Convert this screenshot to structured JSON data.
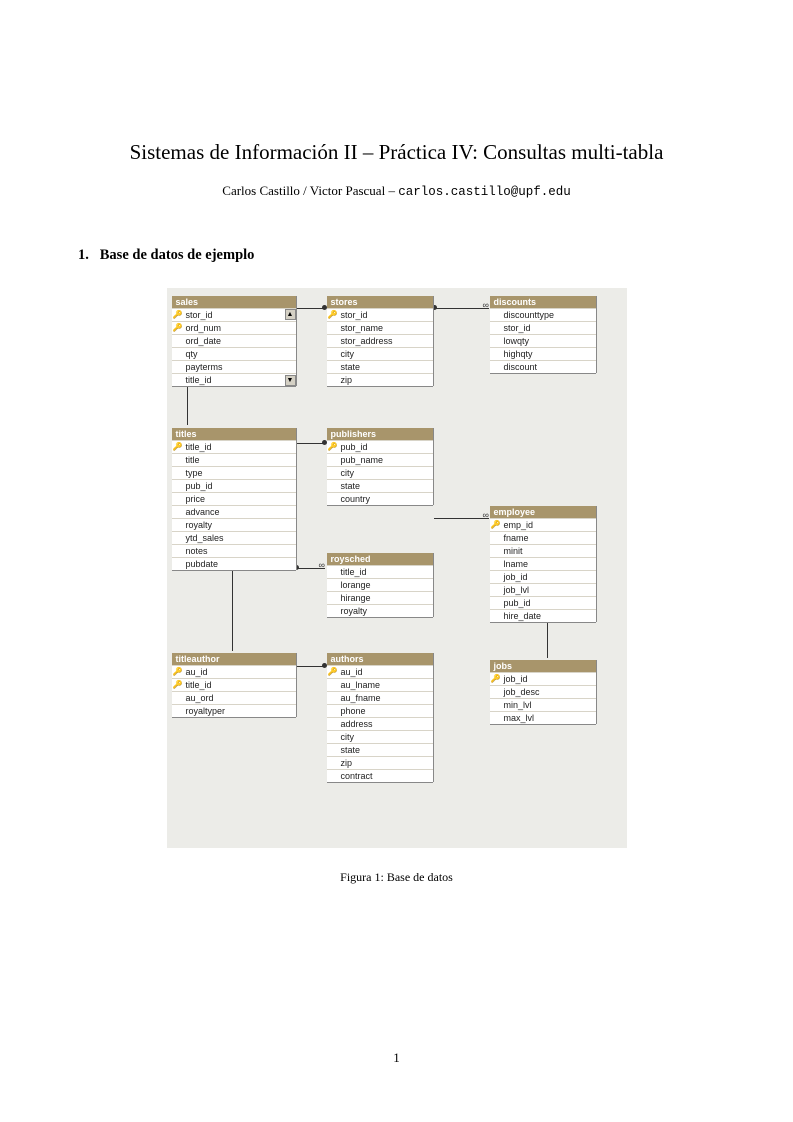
{
  "title": "Sistemas de Información II – Práctica IV: Consultas multi-tabla",
  "authors": "Carlos Castillo / Victor Pascual – ",
  "email": "carlos.castillo@upf.edu",
  "section": {
    "num": "1.",
    "name": "Base de datos de ejemplo"
  },
  "caption": "Figura 1: Base de datos",
  "pagenum": "1",
  "key_glyph": "🔑",
  "scroll_up_glyph": "▲",
  "scroll_dn_glyph": "▼",
  "infinity_glyph": "∞",
  "tables": {
    "sales": {
      "name": "sales",
      "fields": [
        {
          "k": true,
          "n": "stor_id"
        },
        {
          "k": true,
          "n": "ord_num"
        },
        {
          "k": false,
          "n": "ord_date"
        },
        {
          "k": false,
          "n": "qty"
        },
        {
          "k": false,
          "n": "payterms"
        },
        {
          "k": false,
          "n": "title_id"
        }
      ]
    },
    "stores": {
      "name": "stores",
      "fields": [
        {
          "k": true,
          "n": "stor_id"
        },
        {
          "k": false,
          "n": "stor_name"
        },
        {
          "k": false,
          "n": "stor_address"
        },
        {
          "k": false,
          "n": "city"
        },
        {
          "k": false,
          "n": "state"
        },
        {
          "k": false,
          "n": "zip"
        }
      ]
    },
    "discounts": {
      "name": "discounts",
      "fields": [
        {
          "k": false,
          "n": "discounttype"
        },
        {
          "k": false,
          "n": "stor_id"
        },
        {
          "k": false,
          "n": "lowqty"
        },
        {
          "k": false,
          "n": "highqty"
        },
        {
          "k": false,
          "n": "discount"
        }
      ]
    },
    "titles": {
      "name": "titles",
      "fields": [
        {
          "k": true,
          "n": "title_id"
        },
        {
          "k": false,
          "n": "title"
        },
        {
          "k": false,
          "n": "type"
        },
        {
          "k": false,
          "n": "pub_id"
        },
        {
          "k": false,
          "n": "price"
        },
        {
          "k": false,
          "n": "advance"
        },
        {
          "k": false,
          "n": "royalty"
        },
        {
          "k": false,
          "n": "ytd_sales"
        },
        {
          "k": false,
          "n": "notes"
        },
        {
          "k": false,
          "n": "pubdate"
        }
      ]
    },
    "publishers": {
      "name": "publishers",
      "fields": [
        {
          "k": true,
          "n": "pub_id"
        },
        {
          "k": false,
          "n": "pub_name"
        },
        {
          "k": false,
          "n": "city"
        },
        {
          "k": false,
          "n": "state"
        },
        {
          "k": false,
          "n": "country"
        }
      ]
    },
    "roysched": {
      "name": "roysched",
      "fields": [
        {
          "k": false,
          "n": "title_id"
        },
        {
          "k": false,
          "n": "lorange"
        },
        {
          "k": false,
          "n": "hirange"
        },
        {
          "k": false,
          "n": "royalty"
        }
      ]
    },
    "employee": {
      "name": "employee",
      "fields": [
        {
          "k": true,
          "n": "emp_id"
        },
        {
          "k": false,
          "n": "fname"
        },
        {
          "k": false,
          "n": "minit"
        },
        {
          "k": false,
          "n": "lname"
        },
        {
          "k": false,
          "n": "job_id"
        },
        {
          "k": false,
          "n": "job_lvl"
        },
        {
          "k": false,
          "n": "pub_id"
        },
        {
          "k": false,
          "n": "hire_date"
        }
      ]
    },
    "titleauthor": {
      "name": "titleauthor",
      "fields": [
        {
          "k": true,
          "n": "au_id"
        },
        {
          "k": true,
          "n": "title_id"
        },
        {
          "k": false,
          "n": "au_ord"
        },
        {
          "k": false,
          "n": "royaltyper"
        }
      ]
    },
    "authors": {
      "name": "authors",
      "fields": [
        {
          "k": true,
          "n": "au_id"
        },
        {
          "k": false,
          "n": "au_lname"
        },
        {
          "k": false,
          "n": "au_fname"
        },
        {
          "k": false,
          "n": "phone"
        },
        {
          "k": false,
          "n": "address"
        },
        {
          "k": false,
          "n": "city"
        },
        {
          "k": false,
          "n": "state"
        },
        {
          "k": false,
          "n": "zip"
        },
        {
          "k": false,
          "n": "contract"
        }
      ]
    },
    "jobs": {
      "name": "jobs",
      "fields": [
        {
          "k": true,
          "n": "job_id"
        },
        {
          "k": false,
          "n": "job_desc"
        },
        {
          "k": false,
          "n": "min_lvl"
        },
        {
          "k": false,
          "n": "max_lvl"
        }
      ]
    }
  },
  "relationships": [
    {
      "from": "sales.stor_id",
      "to": "stores.stor_id",
      "card": "many-to-one"
    },
    {
      "from": "discounts.stor_id",
      "to": "stores.stor_id",
      "card": "many-to-one"
    },
    {
      "from": "sales.title_id",
      "to": "titles.title_id",
      "card": "many-to-one"
    },
    {
      "from": "titles.pub_id",
      "to": "publishers.pub_id",
      "card": "many-to-one"
    },
    {
      "from": "roysched.title_id",
      "to": "titles.title_id",
      "card": "many-to-one"
    },
    {
      "from": "titleauthor.title_id",
      "to": "titles.title_id",
      "card": "many-to-one"
    },
    {
      "from": "titleauthor.au_id",
      "to": "authors.au_id",
      "card": "many-to-one"
    },
    {
      "from": "employee.pub_id",
      "to": "publishers.pub_id",
      "card": "many-to-one"
    },
    {
      "from": "employee.job_id",
      "to": "jobs.job_id",
      "card": "many-to-one"
    }
  ]
}
